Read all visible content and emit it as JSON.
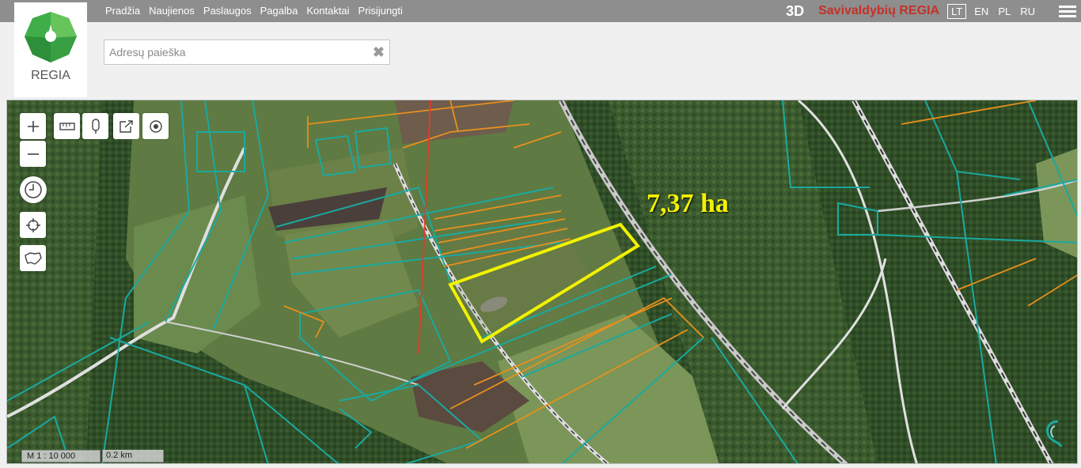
{
  "nav": {
    "items": [
      "Pradžia",
      "Naujienos",
      "Paslaugos",
      "Pagalba",
      "Kontaktai",
      "Prisijungti"
    ]
  },
  "header": {
    "btn_3d": "3D",
    "brand": "Savivaldybių REGIA",
    "languages": [
      "LT",
      "EN",
      "PL",
      "RU"
    ],
    "active_language": "LT"
  },
  "logo": {
    "text": "REGIA"
  },
  "search": {
    "placeholder": "Adresų paieška",
    "value": ""
  },
  "map": {
    "area_label": "7,37 ha",
    "scale_text": "M 1 : 10 000",
    "scale_bar_text": "0.2 km"
  },
  "colors": {
    "topbar": "#8e8e8e",
    "brand": "#c4312a",
    "parcel_boundary": "#1aa9a0",
    "highlight_parcel": "#f2f200",
    "orange_parcel": "#e8901c",
    "road": "#e0e0e0"
  },
  "icons": [
    "zoom-in-icon",
    "zoom-out-icon",
    "measure-icon",
    "marker-icon",
    "share-icon",
    "target-icon",
    "clock-icon",
    "locate-icon",
    "lithuania-shape-icon",
    "hamburger-icon",
    "clear-icon"
  ]
}
